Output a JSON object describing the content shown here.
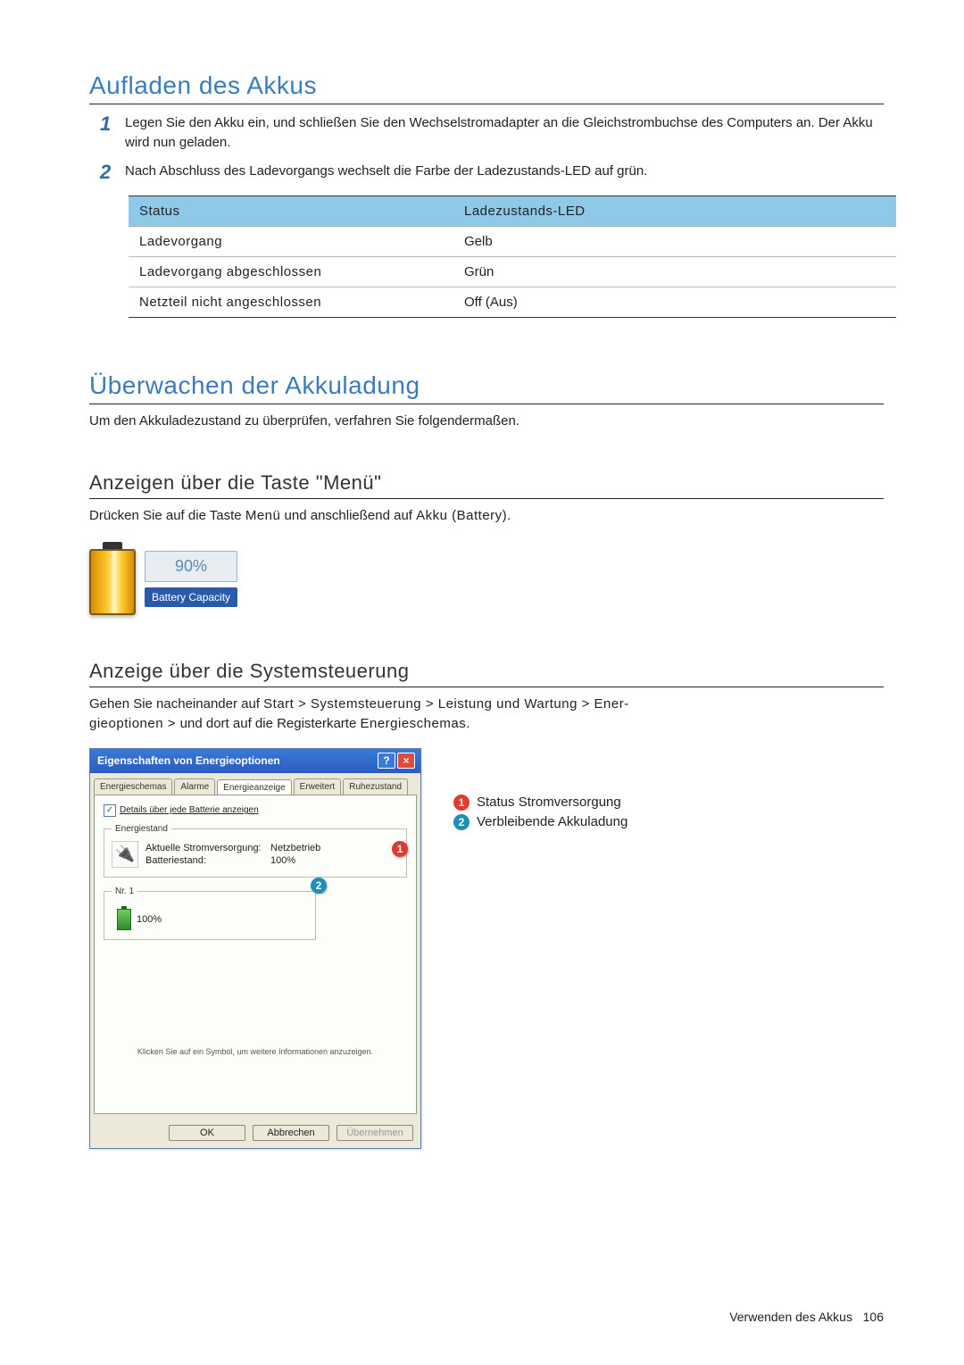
{
  "section1": {
    "title": "Aufladen des Akkus",
    "steps": {
      "1": "Legen Sie den Akku ein, und schließen Sie den Wechselstromadapter an die Gleichstrombuchse des Computers an. Der Akku wird nun geladen.",
      "2": "Nach Abschluss des Ladevorgangs wechselt die Farbe der Ladezustands-LED auf grün."
    },
    "table": {
      "headers": {
        "c1": "Status",
        "c2": "Ladezustands-LED"
      },
      "rows": [
        {
          "c1": "Ladevorgang",
          "c2": "Gelb"
        },
        {
          "c1": "Ladevorgang abgeschlossen",
          "c2": "Grün"
        },
        {
          "c1": "Netzteil nicht angeschlossen",
          "c2": "Off (Aus)"
        }
      ]
    }
  },
  "section2": {
    "title": "Überwachen der Akkuladung",
    "intro": "Um den Akkuladezustand zu überprüfen, verfahren Sie folgendermaßen."
  },
  "sub1": {
    "title": "Anzeigen über die Taste \"Menü\"",
    "text_pre": "Drücken Sie auf die Taste ",
    "text_bold1": "Menü",
    "text_mid": " und anschließend auf ",
    "text_bold2": "Akku (Battery)",
    "text_post": ".",
    "widget_pct": "90%",
    "widget_label": "Battery Capacity"
  },
  "sub2": {
    "title": "Anzeige über die Systemsteuerung",
    "text_pre": "Gehen Sie nacheinander auf ",
    "b1": "Start > Systemsteuerung > Leistung und Wartung > Ener-",
    "b2": "gieoptionen > ",
    "text_mid": "und dort auf die Registerkarte ",
    "b3": "Energieschemas",
    "text_post": "."
  },
  "dialog": {
    "title": "Eigenschaften von Energieoptionen",
    "tabs": {
      "t1": "Energieschemas",
      "t2": "Alarme",
      "t3": "Energieanzeige",
      "t4": "Erweitert",
      "t5": "Ruhezustand"
    },
    "check_label": "Details über jede Batterie anzeigen",
    "fieldset_legend": "Energiestand",
    "row1_label": "Aktuelle Stromversorgung:",
    "row1_value": "Netzbetrieb",
    "row2_label": "Batteriestand:",
    "row2_value": "100%",
    "batt_nr_label": "Nr. 1",
    "batt_nr_value": "100%",
    "hint": "Klicken Sie auf ein Symbol, um weitere Informationen anzuzeigen.",
    "btn_ok": "OK",
    "btn_cancel": "Abbrechen",
    "btn_apply": "Übernehmen"
  },
  "callouts": {
    "c1": "Status Stromversorgung",
    "c2": "Verbleibende Akkuladung"
  },
  "footer": {
    "chapter": "Verwenden des Akkus",
    "page": "106"
  }
}
